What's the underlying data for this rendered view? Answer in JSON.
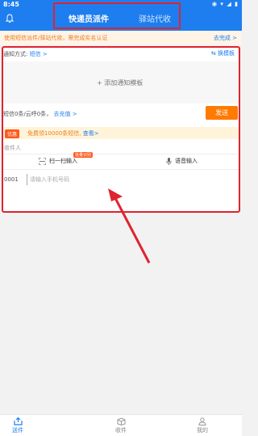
{
  "status_bar": {
    "time": "8:45",
    "icons": "◉ ▾ ◢ ▮"
  },
  "header": {
    "tabs": [
      {
        "label": "快递员派件",
        "active": true
      },
      {
        "label": "驿站代收",
        "active": false
      }
    ]
  },
  "notice": {
    "text": "使用短信派件/驿站代收，需完成实名认证",
    "link": "去完成 >"
  },
  "form": {
    "notify_label": "通知方式:",
    "notify_value": "短信 >",
    "template_change": "换模板",
    "add_template": "+ 添加通知模板",
    "sms_info": "短信0条/云呼0条，",
    "sms_link": "去充值 >",
    "send_button": "发送"
  },
  "promo": {
    "badge": "优惠",
    "text": "免费领10000条短信,",
    "link": "查看>"
  },
  "recipients": {
    "label": "收件人",
    "scan_label": "扫一扫输入",
    "scan_badge": "批量识别",
    "voice_label": "语音输入",
    "row_number": "0001",
    "phone_placeholder": "请输入手机号码"
  },
  "bottom_nav": [
    {
      "label": "送件",
      "icon": "send-box-icon"
    },
    {
      "label": "收件",
      "icon": "receive-box-icon"
    },
    {
      "label": "我的",
      "icon": "person-icon"
    }
  ],
  "colors": {
    "primary": "#1e7ef0",
    "highlight": "#e0232f",
    "send": "#ff7a00"
  }
}
